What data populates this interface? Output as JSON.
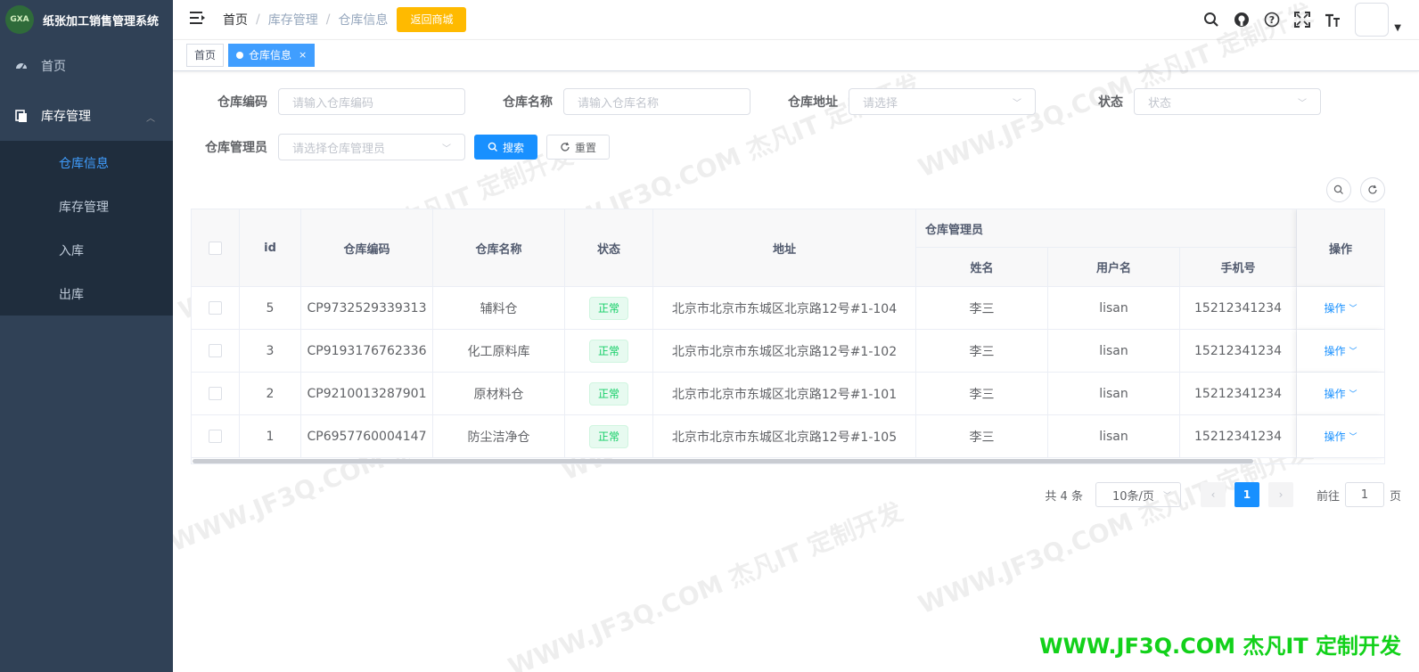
{
  "app": {
    "title": "纸张加工销售管理系统",
    "logo_text": "GXA"
  },
  "sidebar": {
    "items": [
      {
        "label": "首页",
        "icon": "dashboard-icon"
      },
      {
        "label": "库存管理",
        "icon": "documents-icon",
        "expanded": true,
        "children": [
          {
            "label": "仓库信息",
            "active": true
          },
          {
            "label": "库存管理"
          },
          {
            "label": "入库"
          },
          {
            "label": "出库"
          }
        ]
      }
    ]
  },
  "topbar": {
    "breadcrumb": [
      "首页",
      "库存管理",
      "仓库信息"
    ],
    "back_button": "返回商城"
  },
  "tags": [
    {
      "label": "首页",
      "active": false
    },
    {
      "label": "仓库信息",
      "active": true,
      "close": "×"
    }
  ],
  "search": {
    "code_label": "仓库编码",
    "code_placeholder": "请输入仓库编码",
    "name_label": "仓库名称",
    "name_placeholder": "请输入仓库名称",
    "address_label": "仓库地址",
    "address_placeholder": "请选择",
    "status_label": "状态",
    "status_placeholder": "状态",
    "manager_label": "仓库管理员",
    "manager_placeholder": "请选择仓库管理员",
    "search_button": "搜索",
    "reset_button": "重置"
  },
  "table": {
    "headers": {
      "id": "id",
      "code": "仓库编码",
      "name": "仓库名称",
      "status": "状态",
      "address": "地址",
      "manager_group": "仓库管理员",
      "manager_name": "姓名",
      "username": "用户名",
      "phone": "手机号",
      "actions": "操作"
    },
    "rows": [
      {
        "id": "5",
        "code": "CP9732529339313",
        "name": "辅料仓",
        "status": "正常",
        "address": "北京市北京市东城区北京路12号#1-104",
        "manager_name": "李三",
        "username": "lisan",
        "phone": "15212341234",
        "action": "操作"
      },
      {
        "id": "3",
        "code": "CP9193176762336",
        "name": "化工原料库",
        "status": "正常",
        "address": "北京市北京市东城区北京路12号#1-102",
        "manager_name": "李三",
        "username": "lisan",
        "phone": "15212341234",
        "action": "操作"
      },
      {
        "id": "2",
        "code": "CP9210013287901",
        "name": "原材料仓",
        "status": "正常",
        "address": "北京市北京市东城区北京路12号#1-101",
        "manager_name": "李三",
        "username": "lisan",
        "phone": "15212341234",
        "action": "操作"
      },
      {
        "id": "1",
        "code": "CP6957760004147",
        "name": "防尘洁净仓",
        "status": "正常",
        "address": "北京市北京市东城区北京路12号#1-105",
        "manager_name": "李三",
        "username": "lisan",
        "phone": "15212341234",
        "action": "操作"
      }
    ]
  },
  "pagination": {
    "total_text": "共 4 条",
    "page_size": "10条/页",
    "current_page": "1",
    "goto_label": "前往",
    "goto_value": "1",
    "page_suffix": "页"
  },
  "watermark": {
    "text": "WWW.JF3Q.COM 杰凡IT 定制开发",
    "footer": "WWW.JF3Q.COM 杰凡IT  定制开发"
  },
  "colors": {
    "sidebar_bg": "#304156",
    "submenu_bg": "#1f2d3d",
    "primary": "#1890ff",
    "warning": "#ffba00",
    "success": "#13ce66",
    "footer_brand": "#12d11a"
  }
}
